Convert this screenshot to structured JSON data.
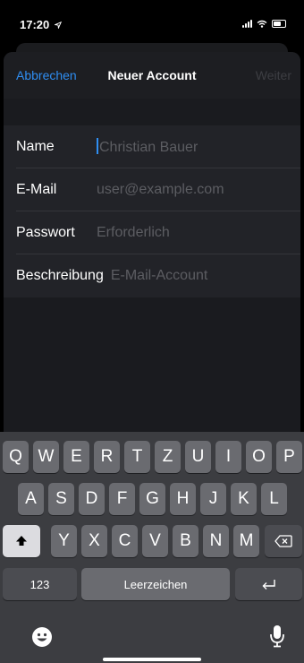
{
  "status": {
    "time": "17:20"
  },
  "nav": {
    "cancel": "Abbrechen",
    "title": "Neuer Account",
    "next": "Weiter"
  },
  "form": {
    "fields": [
      {
        "label": "Name",
        "placeholder": "Christian Bauer"
      },
      {
        "label": "E-Mail",
        "placeholder": "user@example.com"
      },
      {
        "label": "Passwort",
        "placeholder": "Erforderlich"
      },
      {
        "label": "Beschreibung",
        "placeholder": "E-Mail-Account"
      }
    ]
  },
  "keyboard": {
    "row1": [
      "Q",
      "W",
      "E",
      "R",
      "T",
      "Z",
      "U",
      "I",
      "O",
      "P"
    ],
    "row2": [
      "A",
      "S",
      "D",
      "F",
      "G",
      "H",
      "J",
      "K",
      "L"
    ],
    "row3": [
      "Y",
      "X",
      "C",
      "V",
      "B",
      "N",
      "M"
    ],
    "numbers_label": "123",
    "space_label": "Leerzeichen"
  },
  "icons": {
    "location": "location-arrow-icon",
    "signal": "cellular-signal-icon",
    "wifi": "wifi-icon",
    "battery": "battery-icon",
    "shift": "shift-icon",
    "delete": "backspace-icon",
    "return": "return-icon",
    "emoji": "emoji-icon",
    "dictation": "microphone-icon"
  },
  "colors": {
    "accent": "#2f8ef2",
    "background": "#1a1b1f",
    "keyboard": "#3c3d41"
  }
}
